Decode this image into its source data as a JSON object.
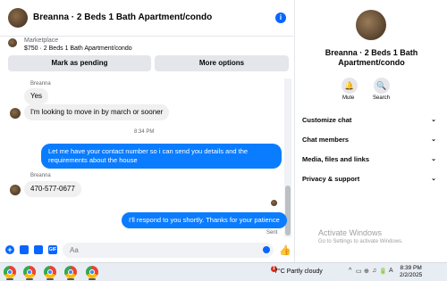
{
  "header": {
    "title": "Breanna · 2 Beds 1 Bath Apartment/condo",
    "info_glyph": "i"
  },
  "marketplace": {
    "label": "Marketplace",
    "detail": "$750 · 2 Beds 1 Bath Apartment/condo",
    "primary_button": "Mark as pending",
    "secondary_button": "More options"
  },
  "messages": [
    {
      "type": "sender",
      "text": "Breanna"
    },
    {
      "type": "in",
      "text": "Yes"
    },
    {
      "type": "in",
      "text": "I'm looking to move in by march or sooner"
    },
    {
      "type": "timestamp",
      "text": "8:34 PM"
    },
    {
      "type": "out",
      "text": "Let me have your contact number so i can send you details and the requirements about the house"
    },
    {
      "type": "sender",
      "text": "Breanna"
    },
    {
      "type": "in",
      "text": "470-577-0677"
    },
    {
      "type": "out",
      "text": "I'll respond to you shortly. Thanks for your patience"
    },
    {
      "type": "status",
      "text": "Sent"
    }
  ],
  "composer": {
    "placeholder": "Aa",
    "plus_glyph": "+",
    "gif_glyph": "GIF",
    "like_glyph": "👍"
  },
  "info_panel": {
    "name": "Breanna · 2 Beds 1 Bath Apartment/condo",
    "mute_label": "Mute",
    "search_label": "Search",
    "mute_glyph": "🔔",
    "search_glyph": "🔍",
    "sections": [
      "Customize chat",
      "Chat members",
      "Media, files and links",
      "Privacy & support"
    ],
    "chevron_glyph": "⌄"
  },
  "watermark": {
    "title": "Activate Windows",
    "subtitle": "Go to Settings to activate Windows."
  },
  "taskbar": {
    "weather_badge": "1",
    "weather": "7°C  Partly cloudy",
    "tray_glyphs": [
      "^",
      "▭",
      "⊕",
      "♫",
      "🔋",
      "A"
    ],
    "time": "8:39 PM",
    "date": "2/2/2025"
  },
  "colors": {
    "accent": "#0866ff",
    "outgoing_bubble": "#0a7cff",
    "incoming_bubble": "#f0f0f0",
    "taskbar": "#e8edf3"
  }
}
